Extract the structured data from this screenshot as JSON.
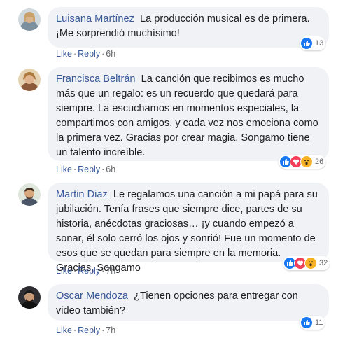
{
  "comments": [
    {
      "name": "Luisana Martínez",
      "text": "La producción musical es de primera. ¡Me sorprendió muchísimo!",
      "reaction_count": "13",
      "like_label": "Like",
      "reply_label": "Reply",
      "time": "6h",
      "reactions": [
        "like"
      ]
    },
    {
      "name": "Francisca Beltrán",
      "text": "La canción que recibimos es mucho más que un regalo: es un recuerdo que quedará para siempre. La escuchamos en momentos especiales, la compartimos con amigos, y cada vez nos emociona como la primera vez. Gracias por crear magia. Songamo tiene un talento increíble.",
      "reaction_count": "26",
      "like_label": "Like",
      "reply_label": "Reply",
      "time": "6h",
      "reactions": [
        "like",
        "love",
        "wow"
      ]
    },
    {
      "name": "Martin Diaz",
      "text": "Le regalamos una canción a mi papá para su jubilación. Tenía frases que siempre dice, partes de su historia, anécdotas graciosas… ¡y cuando empezó a sonar, él solo cerró los ojos y sonrió! Fue un momento de esos que se quedan para siempre en la memoria. Gracias, Songamo",
      "reaction_count": "32",
      "like_label": "Like",
      "reply_label": "Reply",
      "time": "7h",
      "reactions": [
        "like",
        "love",
        "wow"
      ]
    },
    {
      "name": "Oscar Mendoza",
      "text": "¿Tienen opciones para entregar con video también?",
      "reaction_count": "11",
      "like_label": "Like",
      "reply_label": "Reply",
      "time": "7h",
      "reactions": [
        "like"
      ]
    }
  ],
  "colors": {
    "name": "#385898",
    "bubble": "#f0f2f5",
    "like": "#1877f2",
    "love": "#f33e58",
    "wow": "#f7b125"
  }
}
